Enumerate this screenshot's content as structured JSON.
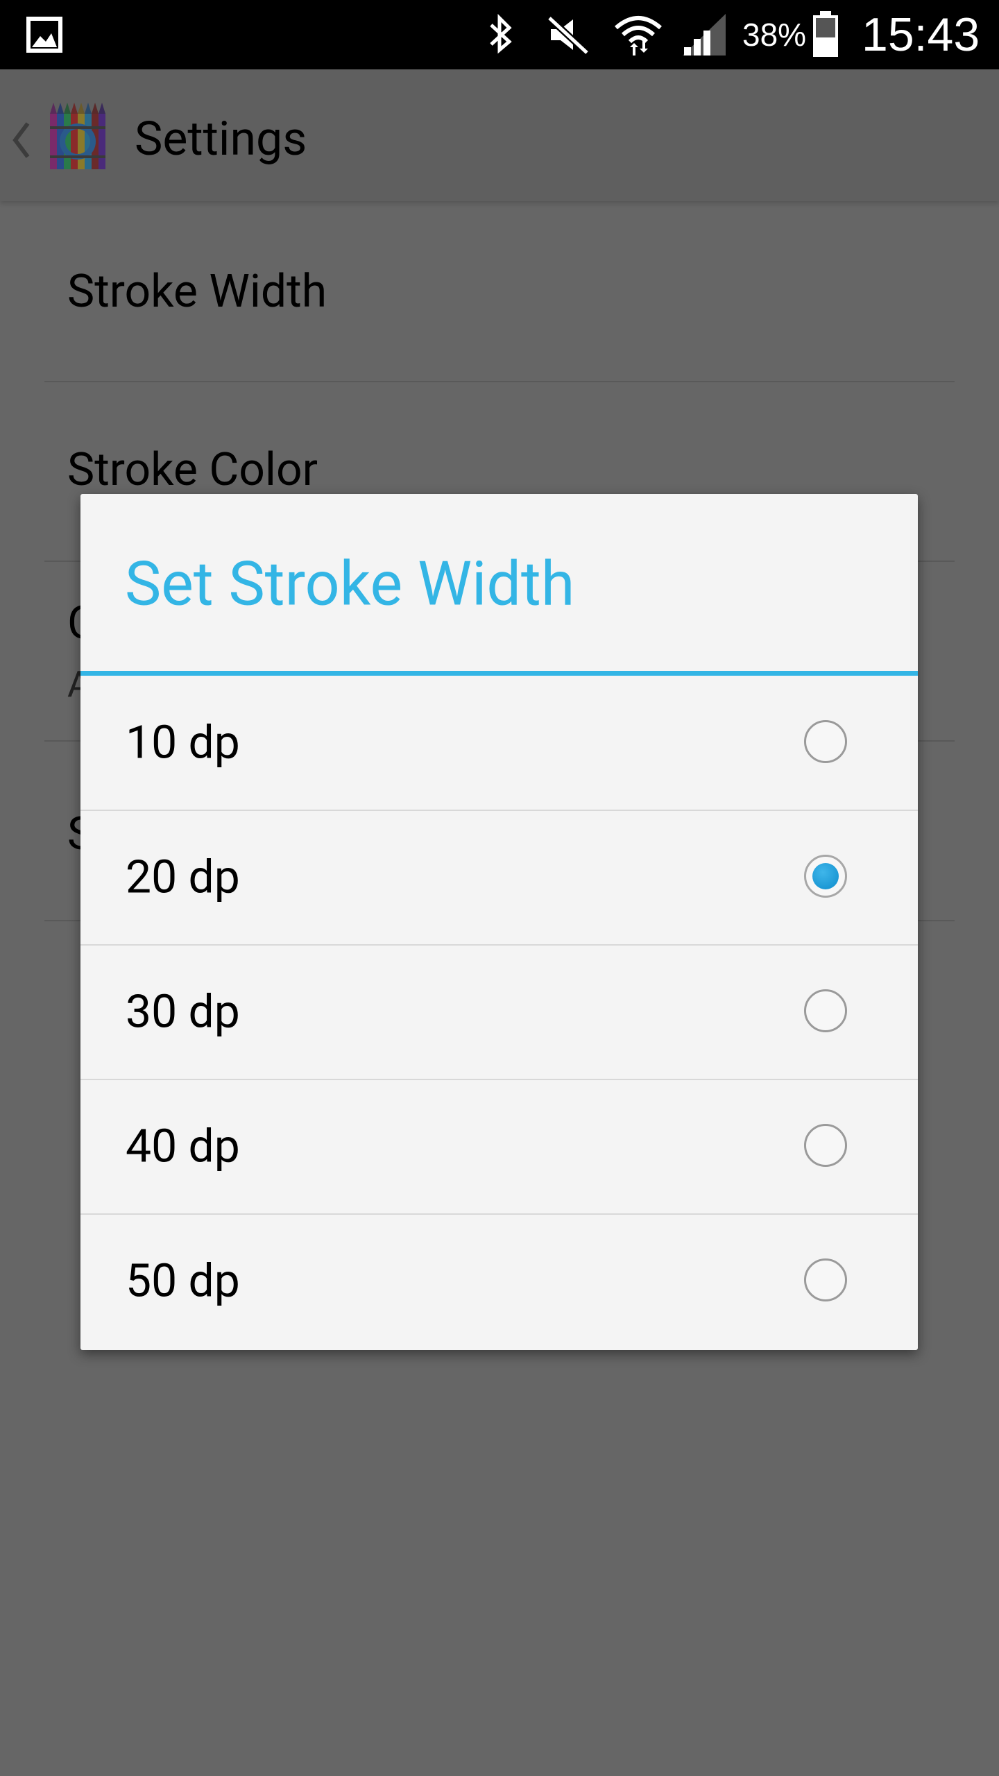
{
  "status_bar": {
    "battery_percent": "38%",
    "time": "15:43",
    "icons": [
      "gallery-icon",
      "bluetooth-icon",
      "mute-icon",
      "wifi-icon",
      "signal-icon",
      "battery-icon"
    ]
  },
  "app_bar": {
    "title": "Settings",
    "app_icon": "crayons-logo-icon"
  },
  "background_settings": {
    "items": [
      {
        "label": "Stroke Width"
      },
      {
        "label": "Stroke Color"
      },
      {
        "label": "C",
        "summary": "A"
      },
      {
        "label": "S"
      }
    ]
  },
  "dialog": {
    "title": "Set Stroke Width",
    "options": [
      {
        "label": "10 dp",
        "selected": false
      },
      {
        "label": "20 dp",
        "selected": true
      },
      {
        "label": "30 dp",
        "selected": false
      },
      {
        "label": "40 dp",
        "selected": false
      },
      {
        "label": "50 dp",
        "selected": false
      }
    ],
    "accent_color": "#33b5e5",
    "radio_color": "#1a9ad6"
  }
}
